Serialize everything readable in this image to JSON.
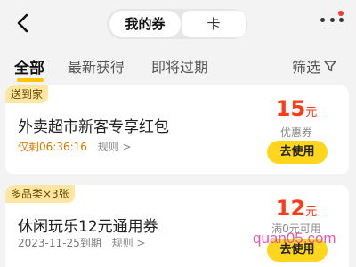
{
  "header": {
    "back_icon": "chevron-left-icon",
    "segments": [
      {
        "label": "我的券",
        "active": true
      },
      {
        "label": "卡",
        "active": false
      }
    ],
    "more_icon": "more-dots-icon",
    "notification_color": "#ff3b30"
  },
  "tabs": {
    "items": [
      {
        "label": "全部",
        "active": true
      },
      {
        "label": "最新获得",
        "active": false
      },
      {
        "label": "即将过期",
        "active": false
      }
    ],
    "filter_label": "筛选",
    "filter_icon": "filter-icon",
    "accent_color": "#ffc300"
  },
  "coupons": [
    {
      "tag": "送到家",
      "title": "外卖超市新客专享红包",
      "remaining": "仅剩06:36:16",
      "rule_label": "规则 >",
      "amount": "15",
      "unit": "元",
      "condition": "优惠券",
      "button": "去使用"
    },
    {
      "tag": "多品类×3张",
      "title": "休闲玩乐12元通用券",
      "expiry": "2023-11-25到期",
      "rule_label": "规则 >",
      "amount": "12",
      "unit": "元",
      "condition": "满0元可用",
      "button": "去使用"
    }
  ],
  "watermark": "quan05.com",
  "colors": {
    "price": "#ff3b14",
    "button": "#ffd51e",
    "tag_bg": "#ffe7a3",
    "countdown": "#d97b00"
  }
}
